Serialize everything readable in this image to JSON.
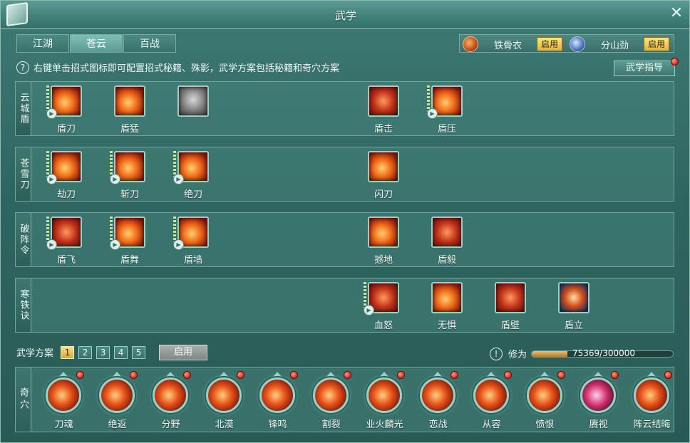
{
  "window": {
    "title": "武学"
  },
  "tabs": [
    {
      "label": "江湖"
    },
    {
      "label": "苍云"
    },
    {
      "label": "百战"
    }
  ],
  "stances": [
    {
      "label": "铁骨衣",
      "button": "启用",
      "icon": "shield-stance-icon"
    },
    {
      "label": "分山劲",
      "button": "启用",
      "icon": "blade-stance-icon"
    }
  ],
  "hint": {
    "text": "右键单击招式图标即可配置招式秘籍、殊影，武学方案包括秘籍和奇穴方案"
  },
  "guide": {
    "label": "武学指导"
  },
  "rows": [
    {
      "label": "云城盾",
      "skills": [
        "盾刀",
        "盾猛",
        "",
        "盾击",
        "盾压"
      ]
    },
    {
      "label": "苍雪刀",
      "skills": [
        "劫刀",
        "斩刀",
        "绝刀",
        "闪刀"
      ]
    },
    {
      "label": "破阵令",
      "skills": [
        "盾飞",
        "盾舞",
        "盾墙",
        "撼地",
        "盾毅"
      ]
    },
    {
      "label": "寒铁诀",
      "skills": [
        "血怒",
        "无惧",
        "盾壁",
        "盾立"
      ]
    }
  ],
  "plan": {
    "label": "武学方案",
    "numbers": [
      "1",
      "2",
      "3",
      "4",
      "5"
    ],
    "selected": "1",
    "apply_label": "启用"
  },
  "cultivation": {
    "label": "修为",
    "text": "75369/300000",
    "progress": 0.2512
  },
  "qixue": {
    "label": "奇穴",
    "items": [
      "刀魂",
      "绝返",
      "分野",
      "北漠",
      "锋鸣",
      "割裂",
      "业火麟光",
      "恋战",
      "从容",
      "愤恨",
      "赓视",
      "阵云结晦"
    ]
  }
}
